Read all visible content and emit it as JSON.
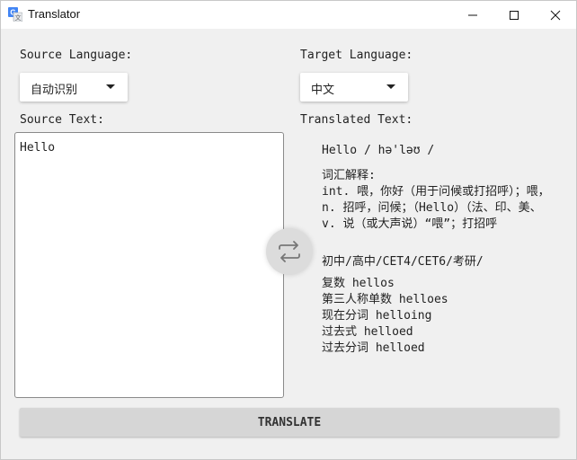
{
  "window": {
    "title": "Translator"
  },
  "source": {
    "label": "Source Language:",
    "selected": "自动识别",
    "text_label": "Source Text:",
    "text": "Hello"
  },
  "target": {
    "label": "Target Language:",
    "selected": "中文",
    "text_label": "Translated Text:"
  },
  "result": {
    "phonetic": "Hello / hə'ləʊ /",
    "gloss_heading": "词汇解释:",
    "gloss": [
      "int. 喂，你好（用于问候或打招呼）；喂，",
      "n. 招呼，问候；（Hello）（法、印、美、",
      "v. 说（或大声说）“喂”；打招呼"
    ],
    "levels": "初中/高中/CET4/CET6/考研/",
    "forms": [
      "复数 hellos",
      "第三人称单数 helloes",
      "现在分词 helloing",
      "过去式 helloed",
      "过去分词 helloed"
    ]
  },
  "buttons": {
    "translate": "TRANSLATE"
  },
  "icons": {
    "app": "translate-app-icon",
    "minimize": "minimize-icon",
    "maximize": "maximize-icon",
    "close": "close-icon",
    "swap": "swap-arrows-icon"
  }
}
